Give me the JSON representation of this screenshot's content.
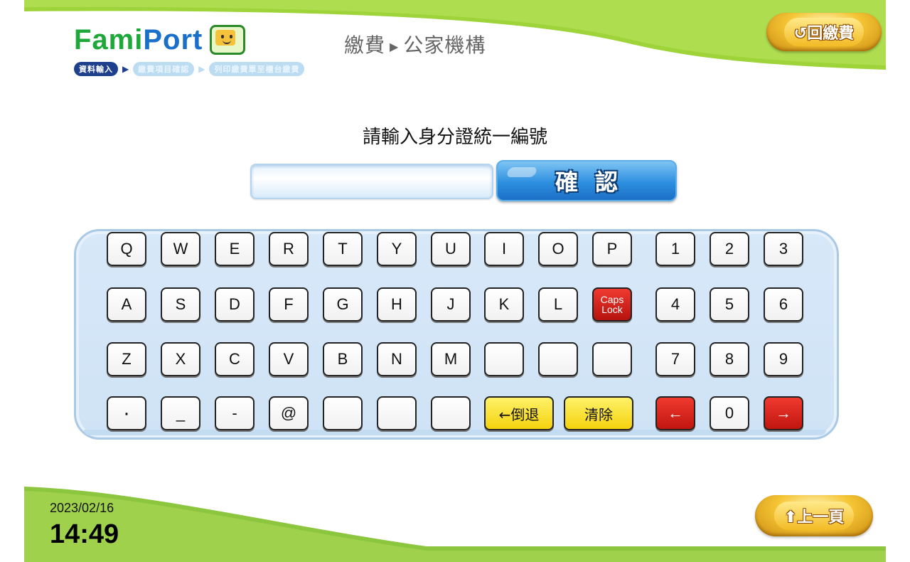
{
  "header": {
    "logo_text_green": "Fami",
    "logo_text_blue": "Port",
    "title_part1": "繳費",
    "title_part2": "公家機構",
    "home_button_label": "回繳費"
  },
  "steps": [
    {
      "label": "資料輸入",
      "active": true
    },
    {
      "label": "繳費項目確認",
      "active": false
    },
    {
      "label": "列印繳費單至櫃台繳費",
      "active": false
    }
  ],
  "form": {
    "prompt": "請輸入身分證統一編號",
    "input_value": "",
    "confirm_label": "確認"
  },
  "keyboard": {
    "rows": [
      [
        "Q",
        "W",
        "E",
        "R",
        "T",
        "Y",
        "U",
        "I",
        "O",
        "P"
      ],
      [
        "A",
        "S",
        "D",
        "F",
        "G",
        "H",
        "J",
        "K",
        "L",
        "Caps Lock"
      ],
      [
        "Z",
        "X",
        "C",
        "V",
        "B",
        "N",
        "M",
        "",
        "",
        ""
      ],
      [
        "·",
        "_",
        "-",
        "@",
        "",
        "",
        ""
      ]
    ],
    "numpad": [
      [
        "1",
        "2",
        "3"
      ],
      [
        "4",
        "5",
        "6"
      ],
      [
        "7",
        "8",
        "9"
      ],
      [
        "←",
        "0",
        "→"
      ]
    ],
    "backspace_label": "←倒退",
    "clear_label": "清除"
  },
  "footer": {
    "date": "2023/02/16",
    "time": "14:49",
    "prev_button_label": "上一頁"
  },
  "colors": {
    "accent_green": "#9ed43a",
    "brand_blue": "#1e3f8c",
    "confirm_blue": "#2d8fe0",
    "keyboard_bg": "#d7e8f8",
    "key_red": "#c0150f",
    "key_yellow": "#f4d20c"
  }
}
